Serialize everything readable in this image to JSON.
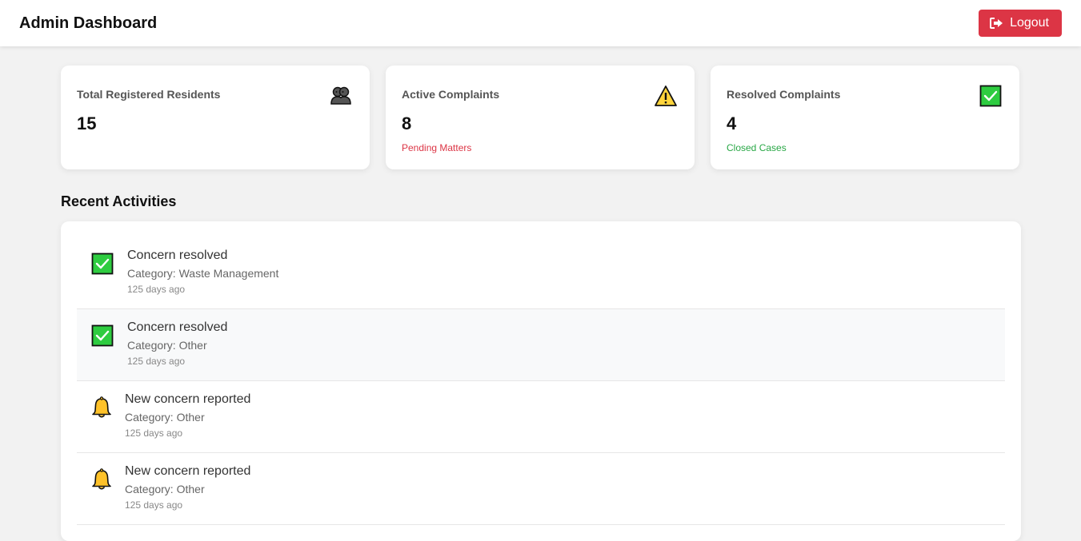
{
  "header": {
    "title": "Admin Dashboard",
    "logout_label": "Logout"
  },
  "stats": [
    {
      "title": "Total Registered Residents",
      "value": "15",
      "subtitle": "",
      "icon": "residents-icon"
    },
    {
      "title": "Active Complaints",
      "value": "8",
      "subtitle": "Pending Matters",
      "icon": "warning-icon"
    },
    {
      "title": "Resolved Complaints",
      "value": "4",
      "subtitle": "Closed Cases",
      "icon": "check-icon"
    }
  ],
  "recent": {
    "title": "Recent Activities",
    "items": [
      {
        "title": "Concern resolved",
        "category": "Category: Waste Management",
        "time": "125 days ago",
        "icon": "check-icon"
      },
      {
        "title": "Concern resolved",
        "category": "Category: Other",
        "time": "125 days ago",
        "icon": "check-icon"
      },
      {
        "title": "New concern reported",
        "category": "Category: Other",
        "time": "125 days ago",
        "icon": "bell-icon"
      },
      {
        "title": "New concern reported",
        "category": "Category: Other",
        "time": "125 days ago",
        "icon": "bell-icon"
      }
    ]
  },
  "colors": {
    "danger": "#dc3545",
    "success": "#28a745",
    "check_green": "#2ecc40",
    "warning_yellow": "#ffd43b",
    "bell_yellow": "#ffc229"
  }
}
